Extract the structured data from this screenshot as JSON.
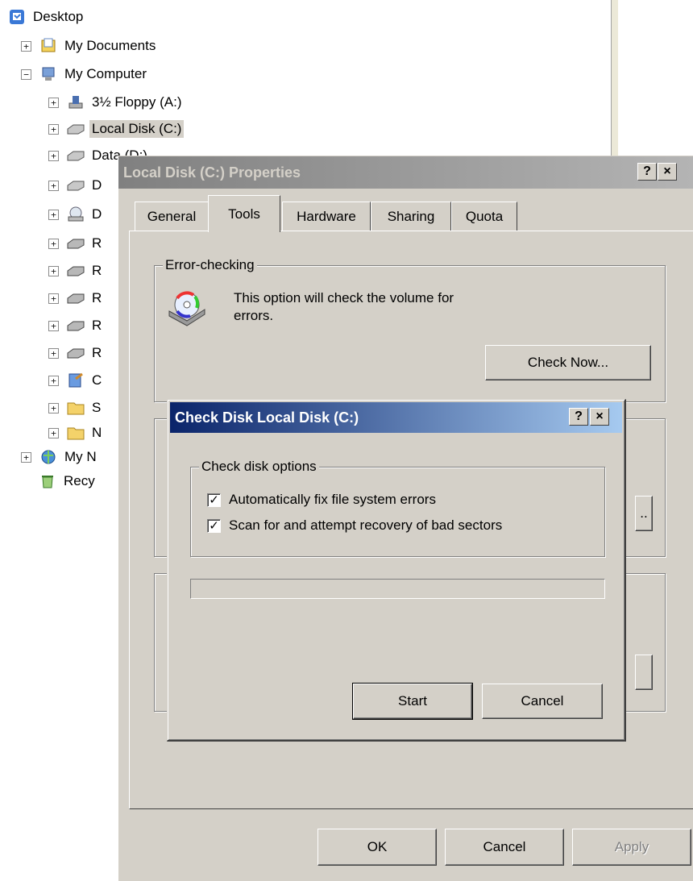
{
  "tree": {
    "items": [
      {
        "label": "Desktop",
        "icon": "desktop-icon",
        "expander": ""
      },
      {
        "label": "My Documents",
        "icon": "my-documents-icon",
        "expander": "+"
      },
      {
        "label": "My Computer",
        "icon": "my-computer-icon",
        "expander": "−"
      },
      {
        "label": "3½ Floppy (A:)",
        "icon": "floppy-drive-icon",
        "expander": "+"
      },
      {
        "label": "Local Disk (C:)",
        "icon": "hard-disk-icon",
        "expander": "+"
      },
      {
        "label": "Data (D:)",
        "icon": "hard-disk-icon",
        "expander": "+"
      },
      {
        "label": "D",
        "icon": "hard-disk-icon",
        "expander": "+"
      },
      {
        "label": "D",
        "icon": "cd-drive-icon",
        "expander": "+"
      },
      {
        "label": "R",
        "icon": "network-drive-icon",
        "expander": "+"
      },
      {
        "label": "R",
        "icon": "network-drive-icon",
        "expander": "+"
      },
      {
        "label": "R",
        "icon": "network-drive-icon",
        "expander": "+"
      },
      {
        "label": "R",
        "icon": "network-drive-icon",
        "expander": "+"
      },
      {
        "label": "R",
        "icon": "network-drive-icon",
        "expander": "+"
      },
      {
        "label": "C",
        "icon": "control-panel-icon",
        "expander": "+"
      },
      {
        "label": "S",
        "icon": "folder-icon",
        "expander": "+"
      },
      {
        "label": "N",
        "icon": "folder-icon",
        "expander": "+"
      },
      {
        "label": "My N",
        "icon": "my-network-icon",
        "expander": "+"
      },
      {
        "label": "Recy",
        "icon": "recycle-bin-icon",
        "expander": ""
      }
    ]
  },
  "properties": {
    "title": "Local Disk (C:) Properties",
    "help_btn": "?",
    "close_btn": "×",
    "tabs": [
      "General",
      "Tools",
      "Hardware",
      "Sharing",
      "Quota"
    ],
    "active_tab": "Tools",
    "error_checking": {
      "legend": "Error-checking",
      "line1": "This option will check the volume for",
      "line2": "errors.",
      "button": "Check Now..."
    },
    "partial_btn_1": "..",
    "ok": "OK",
    "cancel": "Cancel",
    "apply": "Apply"
  },
  "check_disk": {
    "title": "Check Disk Local Disk (C:)",
    "help_btn": "?",
    "close_btn": "×",
    "options_legend": "Check disk options",
    "option1": "Automatically fix file system errors",
    "option2": "Scan for and attempt recovery of bad sectors",
    "option1_checked": true,
    "option2_checked": true,
    "progress": 0,
    "start": "Start",
    "cancel": "Cancel"
  },
  "colors": {
    "active_title_start": "#0a246a",
    "active_title_end": "#a6caf0",
    "inactive_title_start": "#808080",
    "inactive_title_end": "#b5b5b5",
    "face": "#d4d0c8"
  }
}
